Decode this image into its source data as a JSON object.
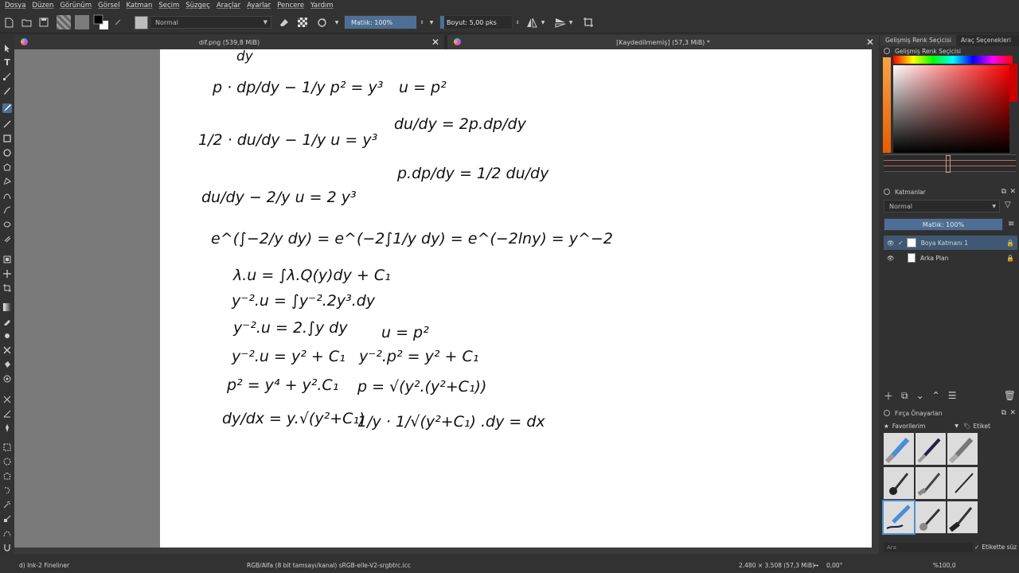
{
  "menu": [
    "Dosya",
    "Düzen",
    "Görünüm",
    "Görsel",
    "Katman",
    "Seçim",
    "Süzgeç",
    "Araçlar",
    "Ayarlar",
    "Pencere",
    "Yardım"
  ],
  "toolbar": {
    "blend_mode": "Normal",
    "opacity_label": "Matlık: 100%",
    "opacity_value": 1.0,
    "size_label": "Boyut: 5,00 pks",
    "size_fraction": 0.05
  },
  "tabs": [
    {
      "title": "dif.png (539,8 MiB)"
    },
    {
      "title": "[Kaydedilmemiş]  (57,3 MiB) *"
    }
  ],
  "colors": {
    "accent": "#4d6f95",
    "canvas_bg": "#7a7a7a",
    "paper": "#ffffff",
    "selected_layer": "#3f5873"
  },
  "dock": {
    "tabs": [
      "Gelişmiş Renk Seçicisi",
      "Araç Seçenekleri"
    ],
    "color_selector_title": "Gelişmiş Renk Seçicisi",
    "layers_title": "Katmanlar",
    "layers_blend": "Normal",
    "layers_opacity": "Matlık:  100%",
    "layers": [
      {
        "name": "Boya Katmanı 1",
        "selected": true
      },
      {
        "name": "Arka Plan",
        "selected": false
      }
    ],
    "brush_title": "Fırça Önayarları",
    "brush_tag": "Favorilerim",
    "brush_tag_button": "Etiket",
    "brush_search_placeholder": "Ara",
    "brush_filter_label": "Etikette süz"
  },
  "status": {
    "brush": "d) Ink-2 Fineliner",
    "colorspace": "RGB/Alfa (8 bit tamsayı/kanal)  sRGB-elle-V2-srgbtrc.icc",
    "dimensions": "2.480 × 3.508 (57,3 MiB)",
    "rotation": "0,00°",
    "zoom": "%100,0"
  },
  "handwriting": {
    "l1": "p · dp/dy − 1/y p² = y³",
    "l2": "1/2 · du/dy − 1/y u = y³",
    "l3": "du/dy − 2/y u = 2 y³",
    "l4": "e^(∫−2/y dy) = e^(−2∫1/y dy) = e^(−2lny) = y^−2",
    "l5": "λ.u = ∫λ.Q(y)dy + C₁",
    "l6": "y⁻².u = ∫y⁻².2y³.dy",
    "l7": "y⁻².u = 2.∫y dy",
    "l8": "y⁻².u = y² + C₁",
    "l9": "p² = y⁴ + y².C₁",
    "l10": "dy/dx = y.√(y²+C₁)",
    "r1": "u = p²",
    "r2": "du/dy = 2p.dp/dy",
    "r3": "p.dp/dy = 1/2 du/dy",
    "r4": "u = p²",
    "r5": "y⁻².p² = y² + C₁",
    "r6": "p = √(y².(y²+C₁))",
    "r7": "1/y · 1/√(y²+C₁) .dy = dx"
  }
}
